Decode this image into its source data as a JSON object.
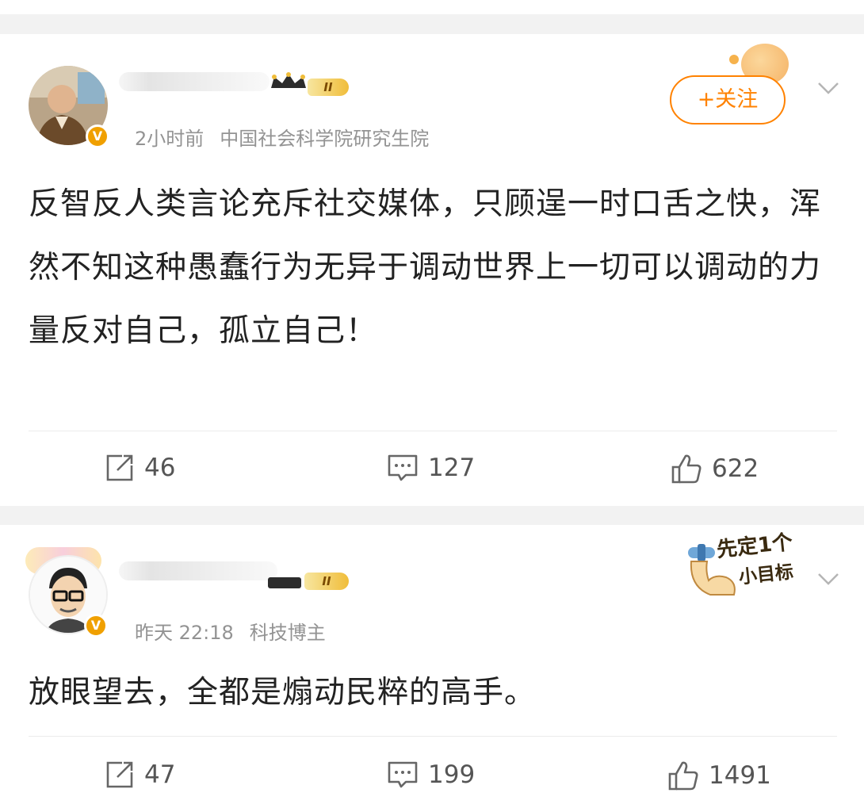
{
  "posts": [
    {
      "level": "II",
      "verified_badge": "V",
      "time": "2小时前",
      "source": "中国社会科学院研究生院",
      "follow_label": "+关注",
      "content": "反智反人类言论充斥社交媒体，只顾逞一时口舌之快，浑然不知这种愚蠢行为无异于调动世界上一切可以调动的力量反对自己，孤立自己！",
      "actions": {
        "repost": "46",
        "comment": "127",
        "like": "622"
      }
    },
    {
      "level": "II",
      "verified_badge": "V",
      "time": "昨天 22:18",
      "source": "科技博主",
      "sticker_line1": "先定1个",
      "sticker_line2": "小目标",
      "content": "放眼望去，全都是煽动民粹的高手。",
      "actions": {
        "repost": "47",
        "comment": "199",
        "like": "1491"
      }
    }
  ],
  "icons": {
    "repost": "repost-icon",
    "comment": "comment-icon",
    "like": "like-icon",
    "more": "chevron-down-icon"
  },
  "colors": {
    "accent": "#ff8200",
    "verified": "#f0a000",
    "meta": "#939393"
  }
}
